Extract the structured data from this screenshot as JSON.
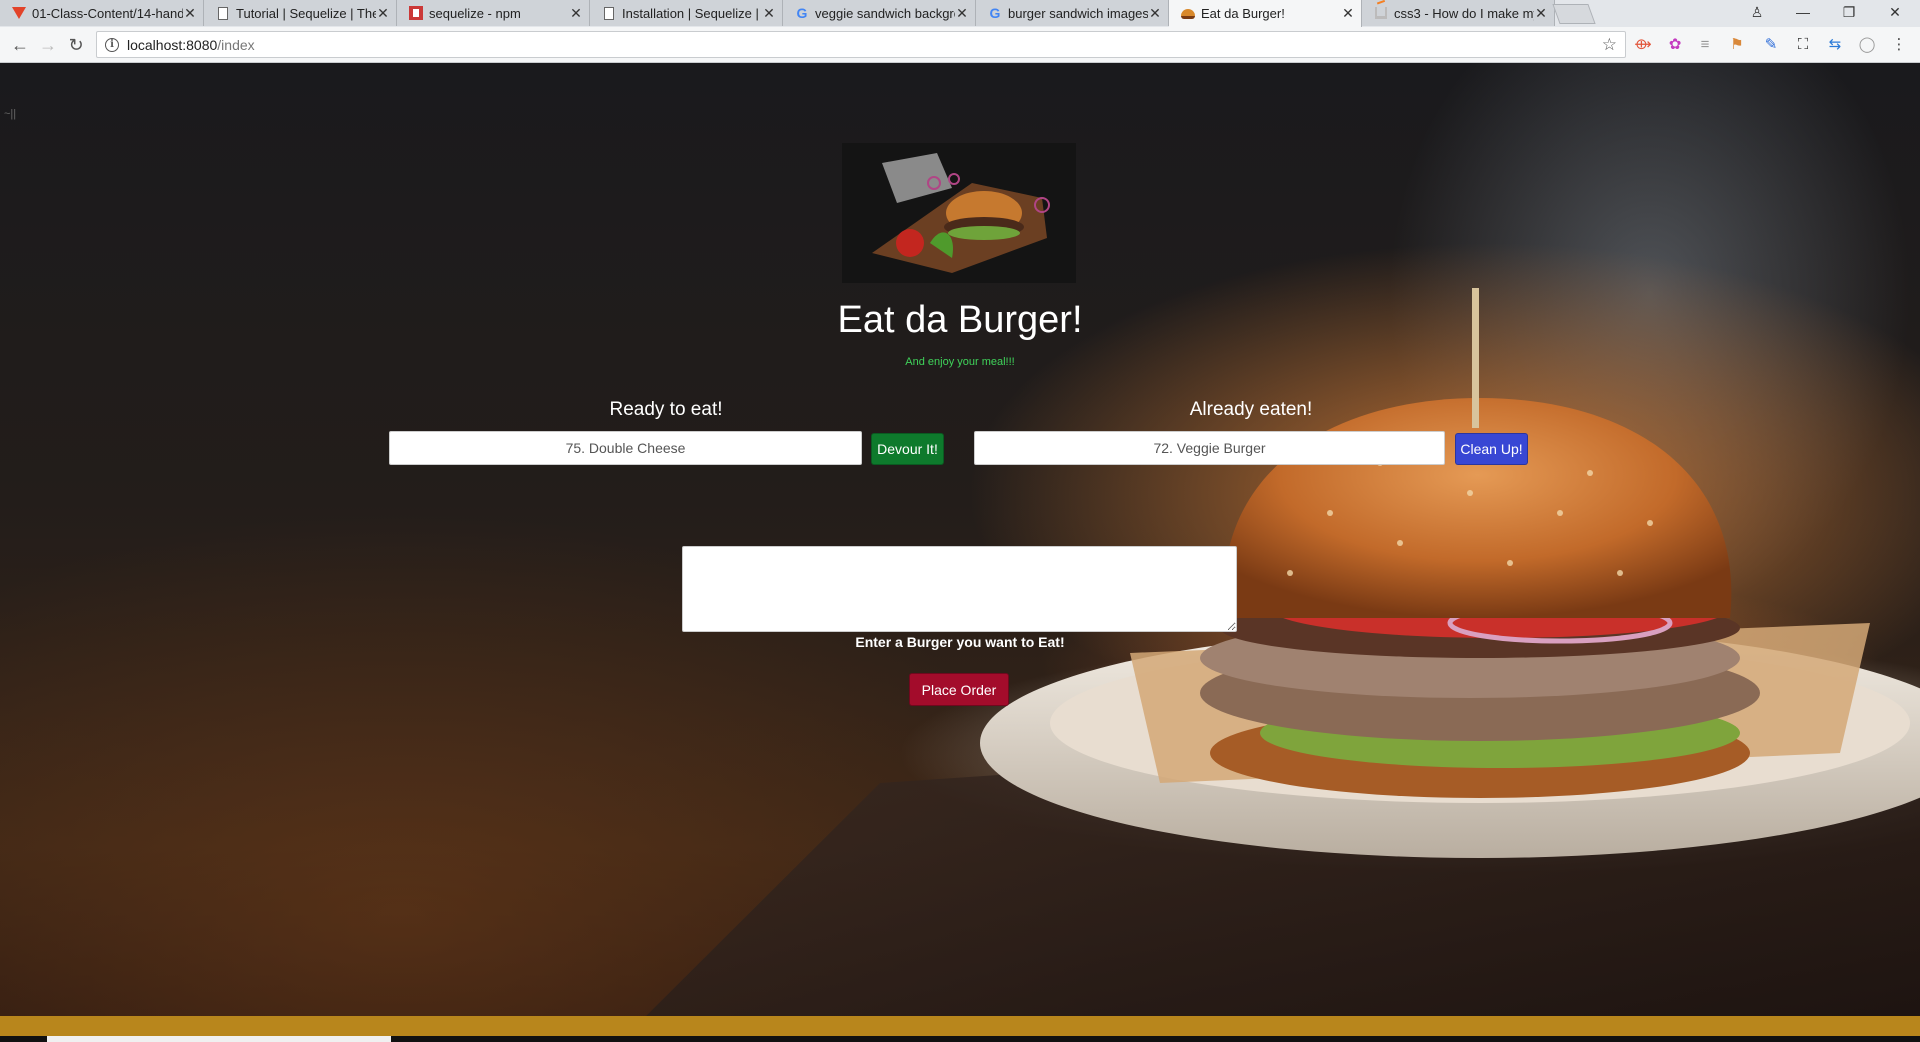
{
  "browser": {
    "tabs": [
      {
        "icon": "gitlab-icon",
        "title": "01-Class-Content/14-handl",
        "active": false
      },
      {
        "icon": "document-icon",
        "title": "Tutorial | Sequelize | The N",
        "active": false
      },
      {
        "icon": "npm-icon",
        "title": "sequelize - npm",
        "active": false
      },
      {
        "icon": "document-icon",
        "title": "Installation | Sequelize | Th",
        "active": false
      },
      {
        "icon": "google-icon",
        "title": "veggie sandwich backgro",
        "active": false
      },
      {
        "icon": "google-icon",
        "title": "burger sandwich images",
        "active": false
      },
      {
        "icon": "burger-icon",
        "title": "Eat da Burger!",
        "active": true
      },
      {
        "icon": "stackoverflow-icon",
        "title": "css3 - How do I make my",
        "active": false
      }
    ],
    "address": {
      "host": "localhost:8080",
      "path": "/index"
    },
    "stray_text": "~||"
  },
  "page": {
    "title": "Eat da Burger!",
    "tagline": "And enjoy your meal!!!",
    "ready_column": {
      "heading": "Ready to eat!",
      "item_value": "75. Double Cheese",
      "button_label": "Devour It!"
    },
    "eaten_column": {
      "heading": "Already eaten!",
      "item_value": "72. Veggie Burger",
      "button_label": "Clean Up!"
    },
    "order_form": {
      "textarea_value": "",
      "label": "Enter a Burger you want to Eat!",
      "button_label": "Place Order"
    }
  },
  "colors": {
    "tagline_green": "#3fd35a",
    "devour_green": "#0e7a2c",
    "cleanup_blue": "#3847d4",
    "order_red": "#a30c2b",
    "footer_gold": "#b8861c"
  }
}
